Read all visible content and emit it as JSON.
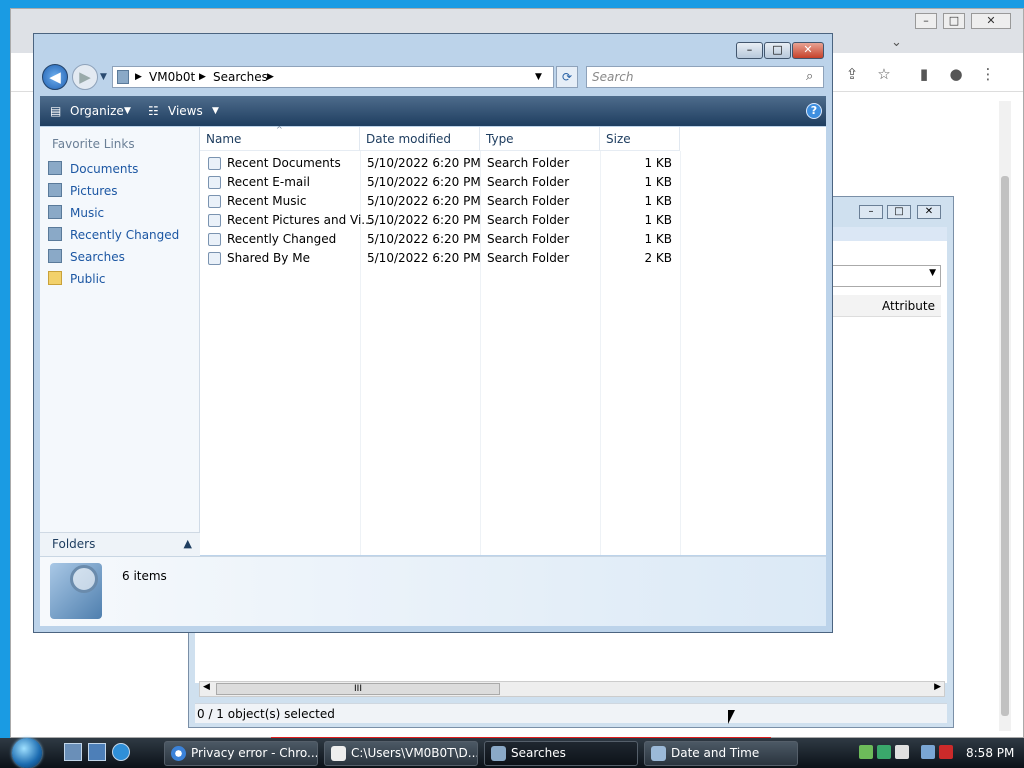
{
  "explorer": {
    "address": {
      "root": "VM0b0t",
      "current": "Searches"
    },
    "search_placeholder": "Search",
    "toolbar": {
      "organize": "Organize",
      "views": "Views",
      "help": "?"
    },
    "nav": {
      "header": "Favorite Links",
      "links": [
        "Documents",
        "Pictures",
        "Music",
        "Recently Changed",
        "Searches",
        "Public"
      ],
      "folders": "Folders"
    },
    "columns": {
      "name": "Name",
      "date": "Date modified",
      "type": "Type",
      "size": "Size"
    },
    "files": [
      {
        "name": "Recent Documents",
        "date": "5/10/2022 6:20 PM",
        "type": "Search Folder",
        "size": "1 KB"
      },
      {
        "name": "Recent E-mail",
        "date": "5/10/2022 6:20 PM",
        "type": "Search Folder",
        "size": "1 KB"
      },
      {
        "name": "Recent Music",
        "date": "5/10/2022 6:20 PM",
        "type": "Search Folder",
        "size": "1 KB"
      },
      {
        "name": "Recent Pictures and Vi...",
        "date": "5/10/2022 6:20 PM",
        "type": "Search Folder",
        "size": "1 KB"
      },
      {
        "name": "Recently Changed",
        "date": "5/10/2022 6:20 PM",
        "type": "Search Folder",
        "size": "1 KB"
      },
      {
        "name": "Shared By Me",
        "date": "5/10/2022 6:20 PM",
        "type": "Search Folder",
        "size": "2 KB"
      }
    ],
    "item_count": "6 items"
  },
  "second_window": {
    "column_header": "Attribute",
    "status": "0 / 1 object(s) selected",
    "scroll_grip": "III"
  },
  "taskbar": {
    "buttons": [
      "Privacy error - Chro...",
      "C:\\Users\\VM0B0T\\D...",
      "Searches",
      "Date and Time"
    ],
    "clock": "8:58 PM"
  },
  "colors": {
    "accent": "#1c57a3",
    "desktop": "#1a9be3",
    "taskbar": "#0b1118"
  }
}
